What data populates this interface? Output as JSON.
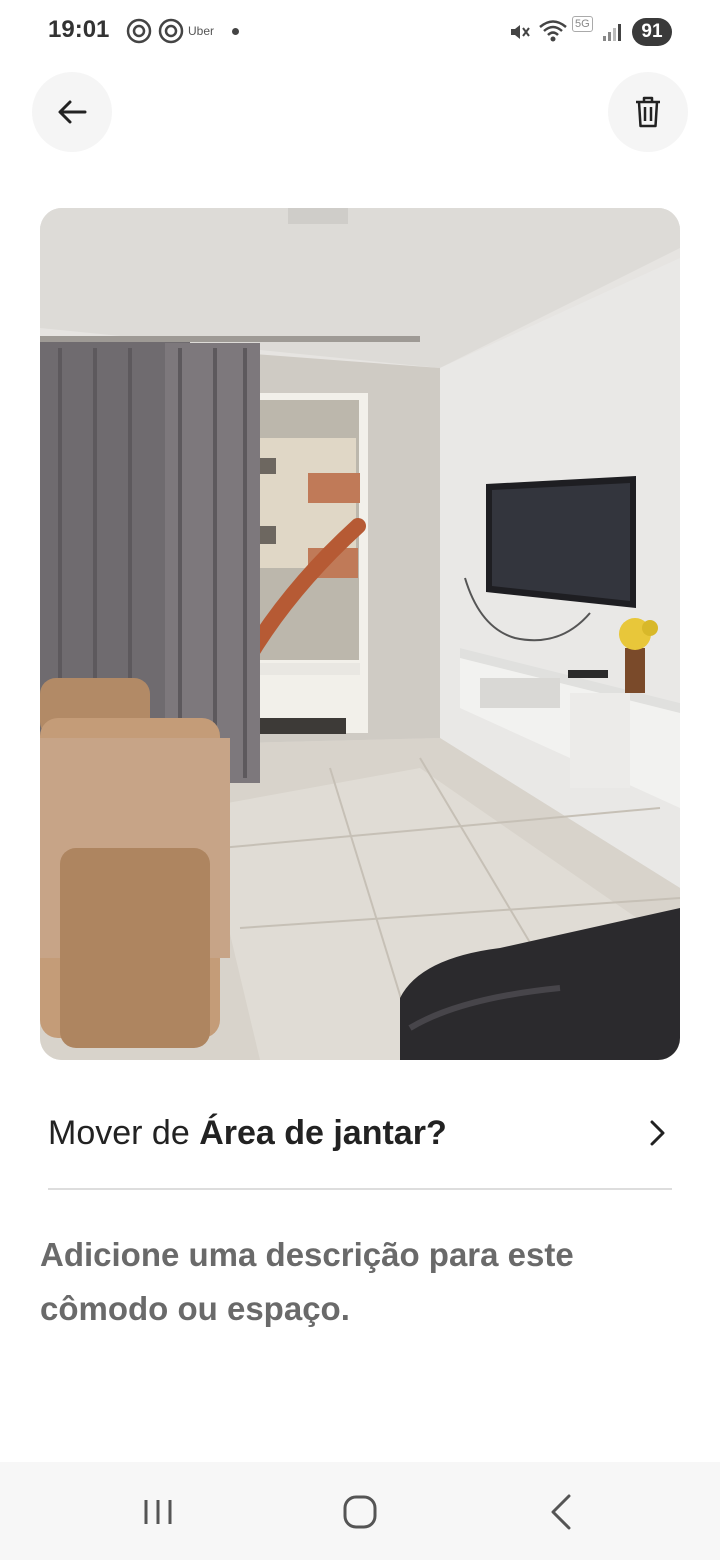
{
  "status_bar": {
    "time": "19:01",
    "uber_label": "Uber",
    "network_label": "5G",
    "battery": "91",
    "icons": [
      "threads-icon",
      "threads-icon",
      "uber-icon",
      "notification-dot-icon",
      "mute-icon",
      "wifi-icon",
      "5g-icon",
      "signal-icon",
      "battery-icon"
    ]
  },
  "header": {
    "back_icon": "arrow-left-icon",
    "delete_icon": "trash-icon"
  },
  "photo": {
    "subject": "living-room-photo"
  },
  "move_row": {
    "prefix": "Mover de ",
    "room": "Área de jantar",
    "suffix": "?",
    "chevron_icon": "chevron-right-icon"
  },
  "description_placeholder": "Adicione uma descrição para este cômodo ou espaço.",
  "nav_bar": {
    "icons": [
      "recent-apps-icon",
      "home-icon",
      "back-icon"
    ]
  },
  "colors": {
    "circle_button_bg": "#f5f5f5",
    "divider": "#dddddd",
    "description_text": "#6a6a6a"
  }
}
